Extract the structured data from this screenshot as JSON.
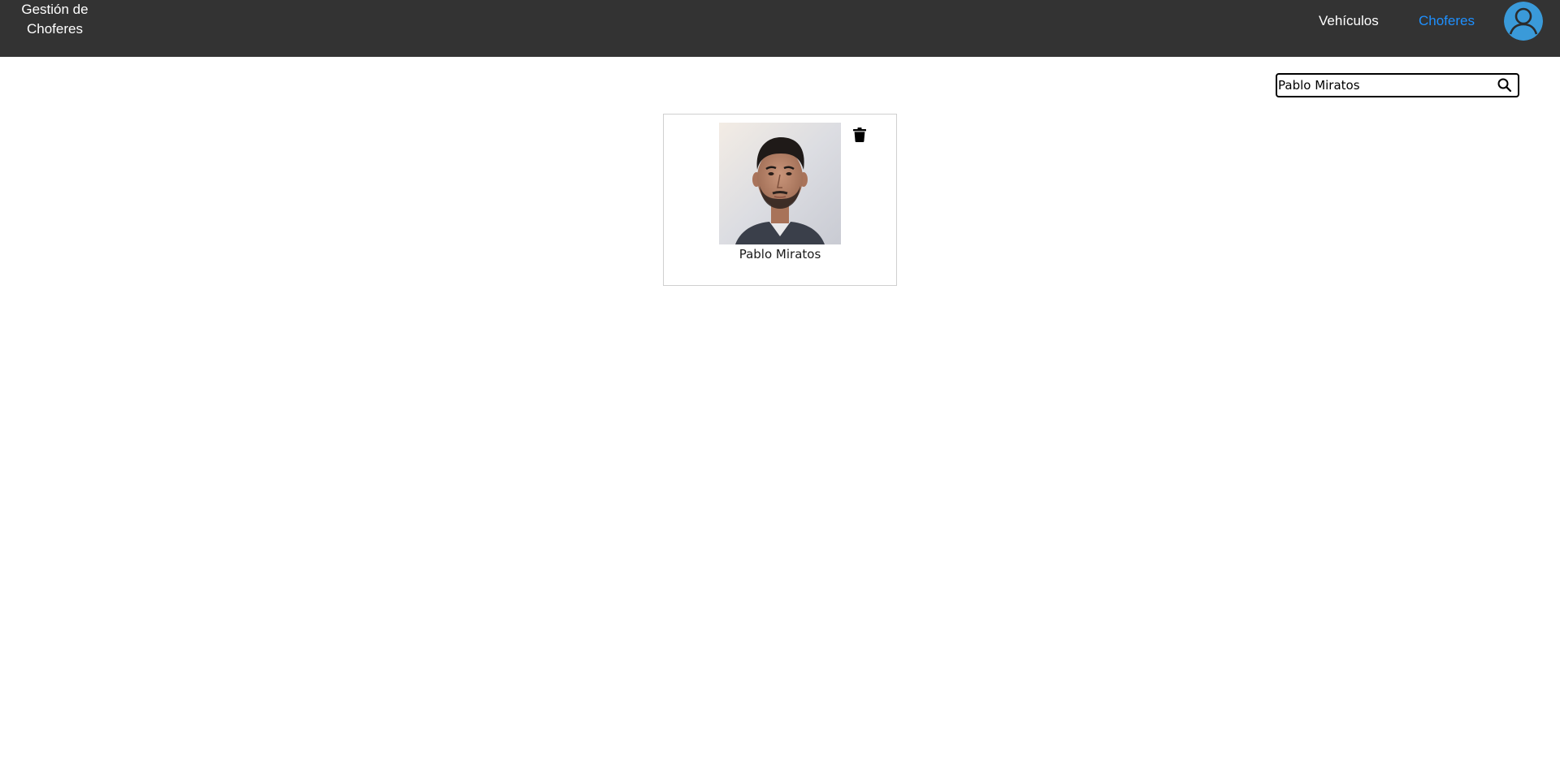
{
  "header": {
    "brand_line1": "Gestión de",
    "brand_line2": "Choferes",
    "nav": [
      {
        "label": "Vehículos",
        "active": false
      },
      {
        "label": "Choferes",
        "active": true
      }
    ],
    "active_color": "#1e90ff",
    "bar_color": "#333333",
    "avatar_icon": "user-circle-icon",
    "avatar_color": "#3a9ad9"
  },
  "search": {
    "value": "Pablo Miratos",
    "icon": "search-icon"
  },
  "results": [
    {
      "name": "Pablo Miratos",
      "photo": "driver-portrait",
      "delete_icon": "trash-icon"
    }
  ]
}
